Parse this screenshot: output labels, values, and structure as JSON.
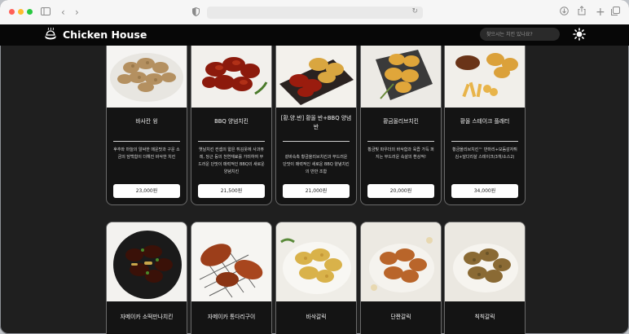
{
  "site": {
    "brand": "Chicken House",
    "search_placeholder": "찾으시는 치킨 있나요?"
  },
  "colors": {
    "header_bg": "#070707",
    "page_bg": "#1f1f1f",
    "card_border": "#6a6a6a"
  },
  "icons": [
    "sidebar-icon",
    "back-icon",
    "forward-icon",
    "shield-icon",
    "reload-icon",
    "download-icon",
    "share-icon",
    "new-tab-icon",
    "tabs-icon",
    "chicken-logo-icon",
    "sun-icon"
  ],
  "products": [
    {
      "name": "바사칸 윙",
      "desc": "후추와 마늘의 알싸한 매운맛과 구운 소금의 담백함이 더해진 바삭한 치킨",
      "price": "23,000원"
    },
    {
      "name": "BBQ 양념치킨",
      "desc": "옛날치킨 컨셉의 얇은 튀김옷에 사과퓨레, 당근 등의 천연재료를 가미하여 부드러운 단맛이 매력적인 BBQ의 새로운 양념치킨",
      "price": "21,500원"
    },
    {
      "name": "[황.양.반] 황올 반+BBQ 양념 반",
      "desc": "겉바속촉 황금올리브치킨과 부드러운 단맛이 매력적인 새로운 BBQ 양념치킨의 반반 조합",
      "price": "21,000원"
    },
    {
      "name": "황금올리브치킨",
      "desc": "황금빛 파우더의 바삭함과 육즙 가득 퍼지는 부드러운 속살의 환상적!",
      "price": "20,000원"
    },
    {
      "name": "황올 스테이크 플래터",
      "desc": "황금올리브치킨™ 반마리+모둠감자튀김+달다리살 스테이크(3개/소스2)",
      "price": "34,000원"
    },
    {
      "name": "자메이카 소떡만나치킨",
      "desc": "",
      "price": ""
    },
    {
      "name": "자메이카 통다리구이",
      "desc": "",
      "price": ""
    },
    {
      "name": "바삭갈릭",
      "desc": "",
      "price": ""
    },
    {
      "name": "단짠갈릭",
      "desc": "",
      "price": ""
    },
    {
      "name": "칙칙갈릭",
      "desc": "",
      "price": ""
    }
  ]
}
